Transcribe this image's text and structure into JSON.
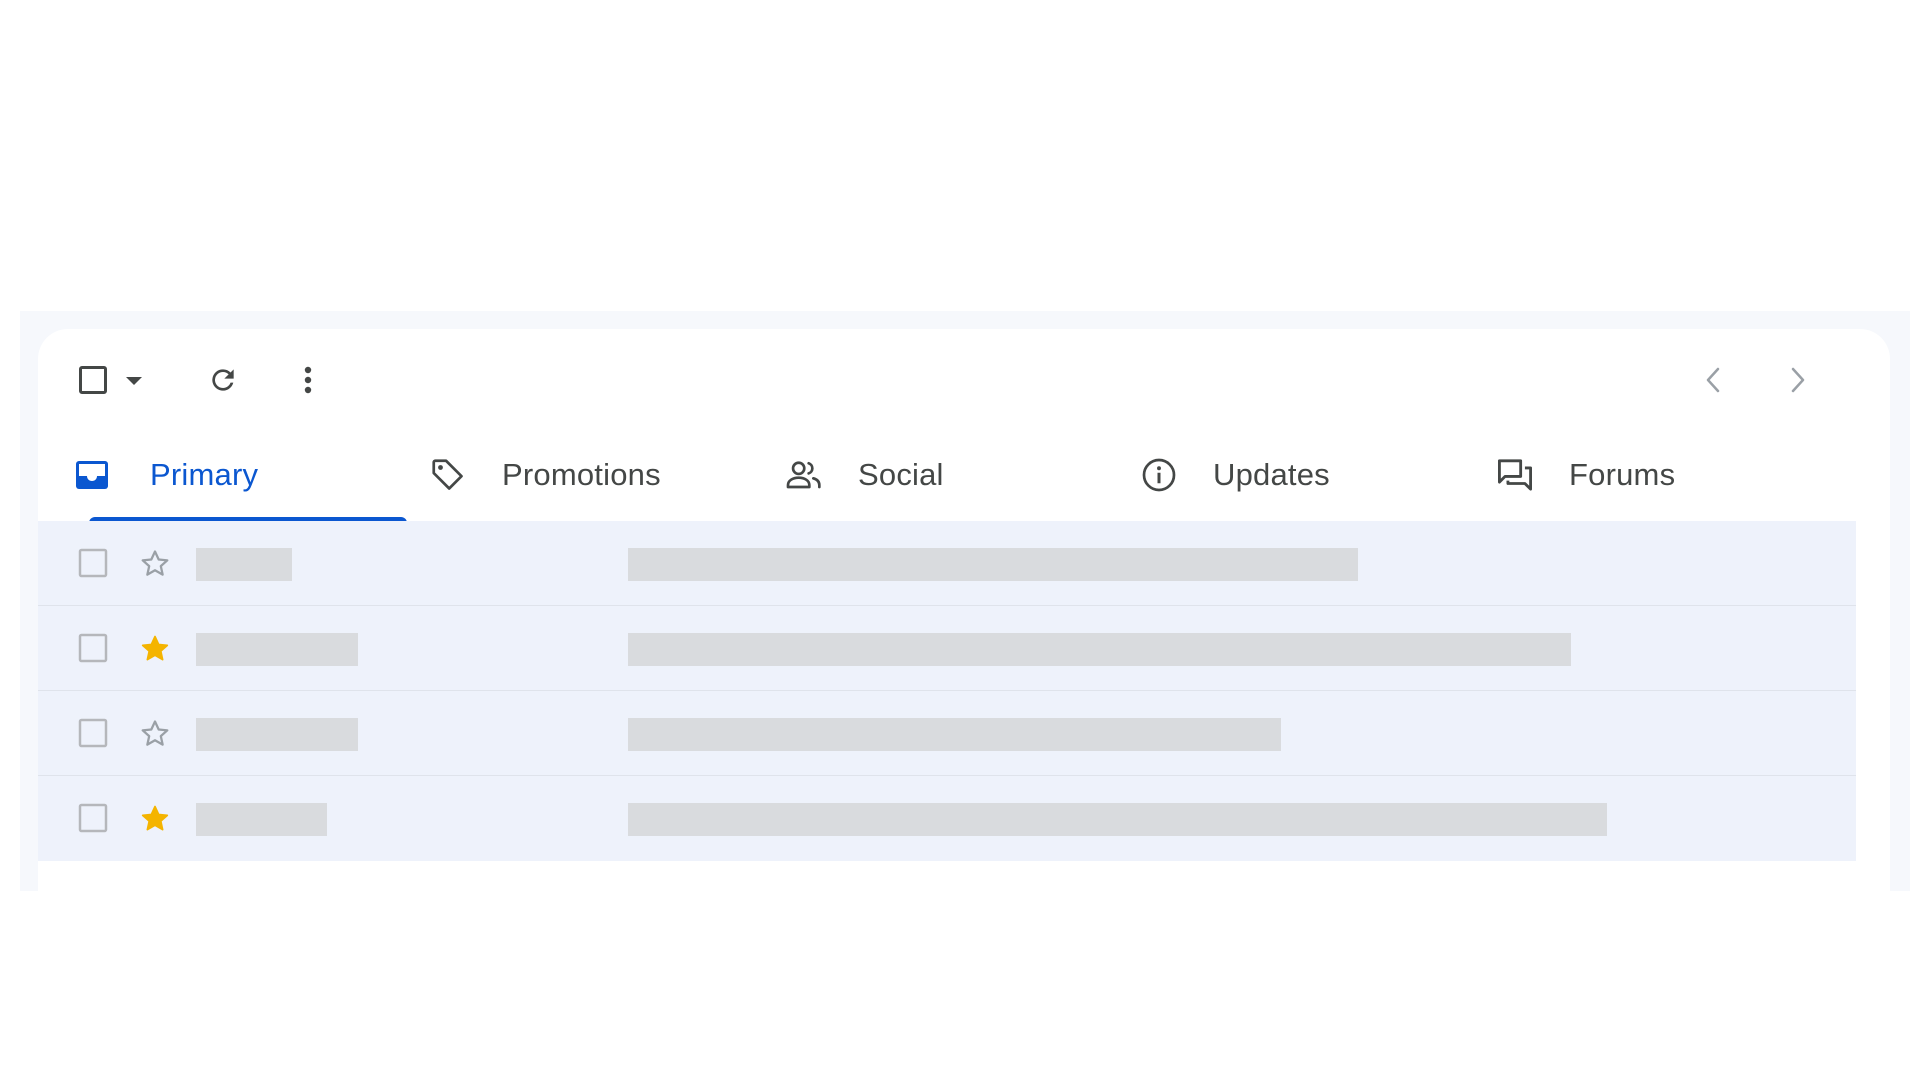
{
  "toolbar": {
    "icons": [
      "checkbox-icon",
      "caret-down-icon",
      "refresh-icon",
      "more-vert-icon",
      "chevron-left-icon",
      "chevron-right-icon"
    ]
  },
  "tabs": [
    {
      "label": "Primary",
      "icon": "inbox-icon",
      "active": true
    },
    {
      "label": "Promotions",
      "icon": "tag-icon",
      "active": false
    },
    {
      "label": "Social",
      "icon": "people-icon",
      "active": false
    },
    {
      "label": "Updates",
      "icon": "info-icon",
      "active": false
    },
    {
      "label": "Forums",
      "icon": "forum-icon",
      "active": false
    }
  ],
  "emails": [
    {
      "starred": false
    },
    {
      "starred": true
    },
    {
      "starred": false
    },
    {
      "starred": true
    }
  ],
  "colors": {
    "accent": "#0b57d0",
    "star": "#f4b400",
    "row_background": "#eef2fb",
    "placeholder": "#d9dbde"
  }
}
